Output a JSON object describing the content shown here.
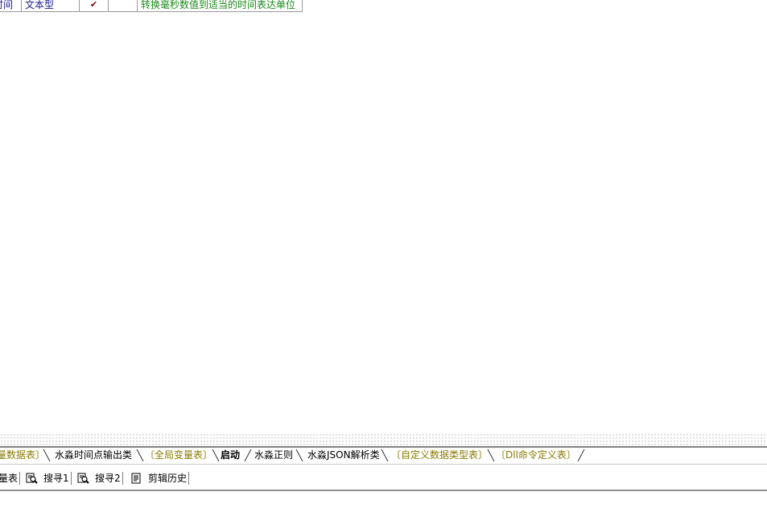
{
  "table_row": {
    "name": "时间",
    "type": "文本型",
    "check": "✔",
    "empty": "",
    "note": "转换毫秒数值到适当的时间表达单位"
  },
  "tabs": [
    {
      "label": "量数据表〕",
      "style": "olive"
    },
    {
      "label": "水淼时间点输出类",
      "style": "normal"
    },
    {
      "label": "〔全局变量表〕",
      "style": "olive"
    },
    {
      "label": "启动",
      "style": "active"
    },
    {
      "label": "水淼正则",
      "style": "normal"
    },
    {
      "label": "水淼JSON解析类",
      "style": "normal"
    },
    {
      "label": "〔自定义数据类型表〕",
      "style": "olive"
    },
    {
      "label": "〔Dll命令定义表〕",
      "style": "olive"
    }
  ],
  "panel": {
    "item0": "量表",
    "item1": "搜寻1",
    "item2": "搜寻2",
    "item3": "剪辑历史",
    "icons": [
      "search-doc-icon",
      "search-doc-icon",
      "clipboard-history-icon"
    ]
  }
}
